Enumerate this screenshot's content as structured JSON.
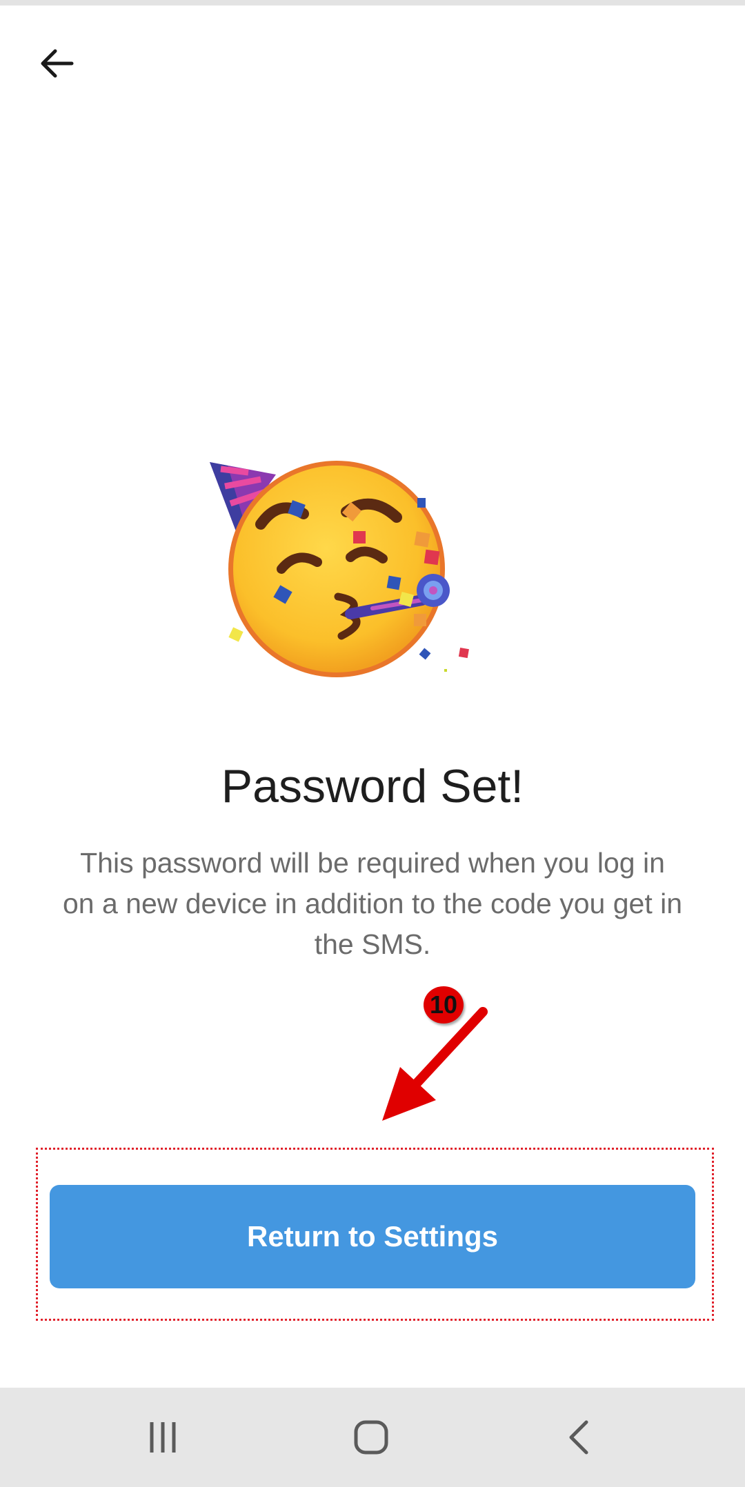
{
  "header": {
    "back_icon": "arrow-left-icon"
  },
  "illustration": {
    "icon": "party-face-emoji"
  },
  "content": {
    "title": "Password Set!",
    "description": "This password will be required when you log in on a new device in addition to the code you get in the SMS."
  },
  "annotation": {
    "step_number": "10",
    "color": "#e00000"
  },
  "actions": {
    "return_label": "Return to Settings",
    "button_color": "#4497e0"
  },
  "nav": {
    "recents_icon": "recents-icon",
    "home_icon": "home-icon",
    "back_icon": "back-chevron-icon"
  }
}
